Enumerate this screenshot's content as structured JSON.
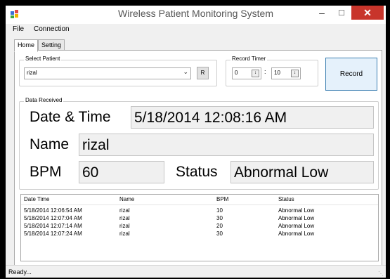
{
  "window": {
    "title": "Wireless Patient Monitoring System"
  },
  "menu": [
    "File",
    "Connection"
  ],
  "tabs": [
    "Home",
    "Setting"
  ],
  "select_patient": {
    "label": "Select Patient",
    "value": "rizal",
    "button": "R"
  },
  "record_timer": {
    "label": "Record Timer",
    "minutes": "0",
    "separator": ":",
    "seconds": "10"
  },
  "record_button": "Record",
  "data_received": {
    "label": "Data Received",
    "datetime_label": "Date & Time",
    "datetime_value": "5/18/2014 12:08:16 AM",
    "name_label": "Name",
    "name_value": "rizal",
    "bpm_label": "BPM",
    "bpm_value": "60",
    "status_label": "Status",
    "status_value": "Abnormal Low"
  },
  "log": {
    "columns": [
      "Date Time",
      "Name",
      "BPM",
      "Status"
    ],
    "rows": [
      [
        "5/18/2014 12:06:54 AM",
        "rizal",
        "10",
        "Abnormal Low"
      ],
      [
        "5/18/2014 12:07:04 AM",
        "rizal",
        "30",
        "Abnormal Low"
      ],
      [
        "5/18/2014 12:07:14 AM",
        "rizal",
        "20",
        "Abnormal Low"
      ],
      [
        "5/18/2014 12:07:24 AM",
        "rizal",
        "30",
        "Abnormal Low"
      ]
    ]
  },
  "statusbar": "Ready...",
  "icons": {
    "close": "close-icon",
    "minimize": "minimize-icon",
    "maximize": "maximize-icon",
    "app": "app-icon"
  },
  "colors": {
    "close_button": "#c8352b",
    "record_button": "#e5f1fb"
  }
}
